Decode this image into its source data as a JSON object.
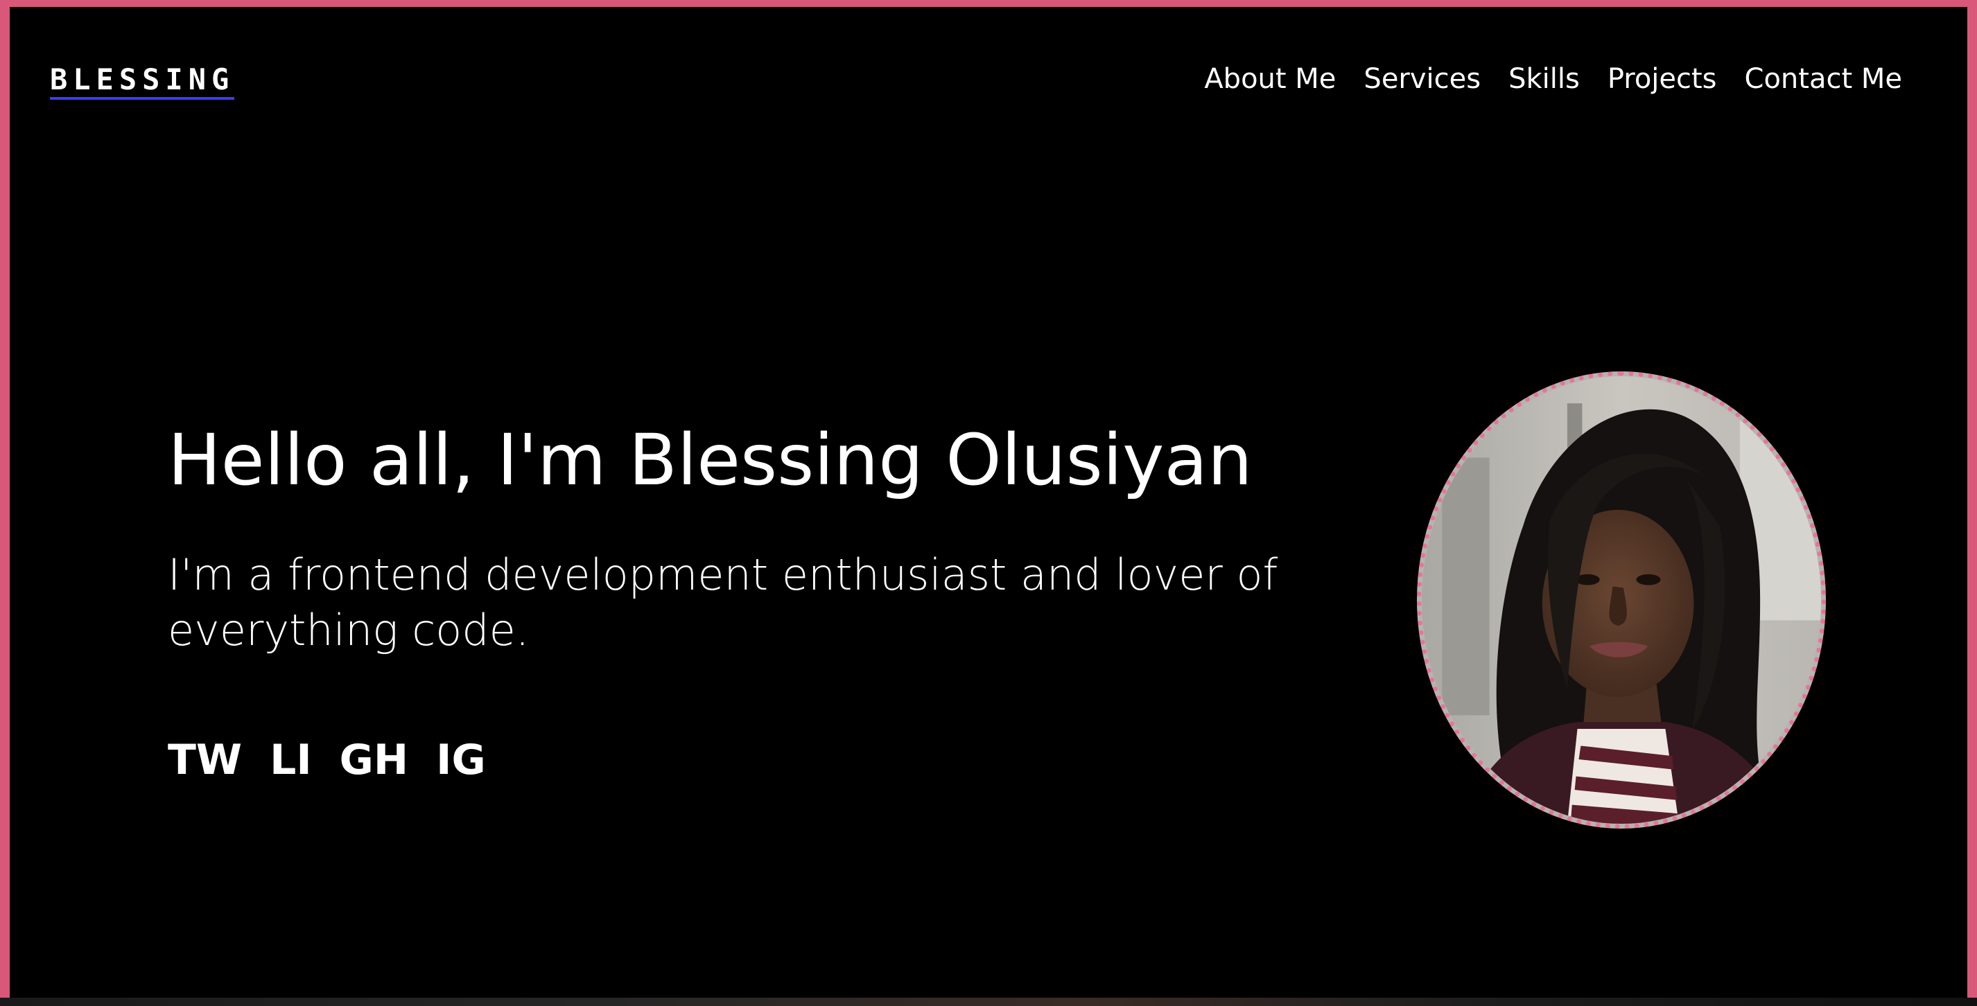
{
  "brand": {
    "logo_text": "BLESSING"
  },
  "nav": {
    "items": [
      {
        "label": "About Me"
      },
      {
        "label": "Services"
      },
      {
        "label": "Skills"
      },
      {
        "label": "Projects"
      },
      {
        "label": "Contact Me"
      }
    ]
  },
  "hero": {
    "title": "Hello all, I'm Blessing Olusiyan",
    "subtitle": "I'm a frontend development enthusiast and lover of everything code."
  },
  "socials": [
    {
      "label": "TW"
    },
    {
      "label": "LI"
    },
    {
      "label": "GH"
    },
    {
      "label": "IG"
    }
  ],
  "colors": {
    "frame_accent": "#d9587a",
    "avatar_border": "#e8739a",
    "logo_underline": "#3b3bff",
    "background": "#000000",
    "text": "#ffffff"
  }
}
